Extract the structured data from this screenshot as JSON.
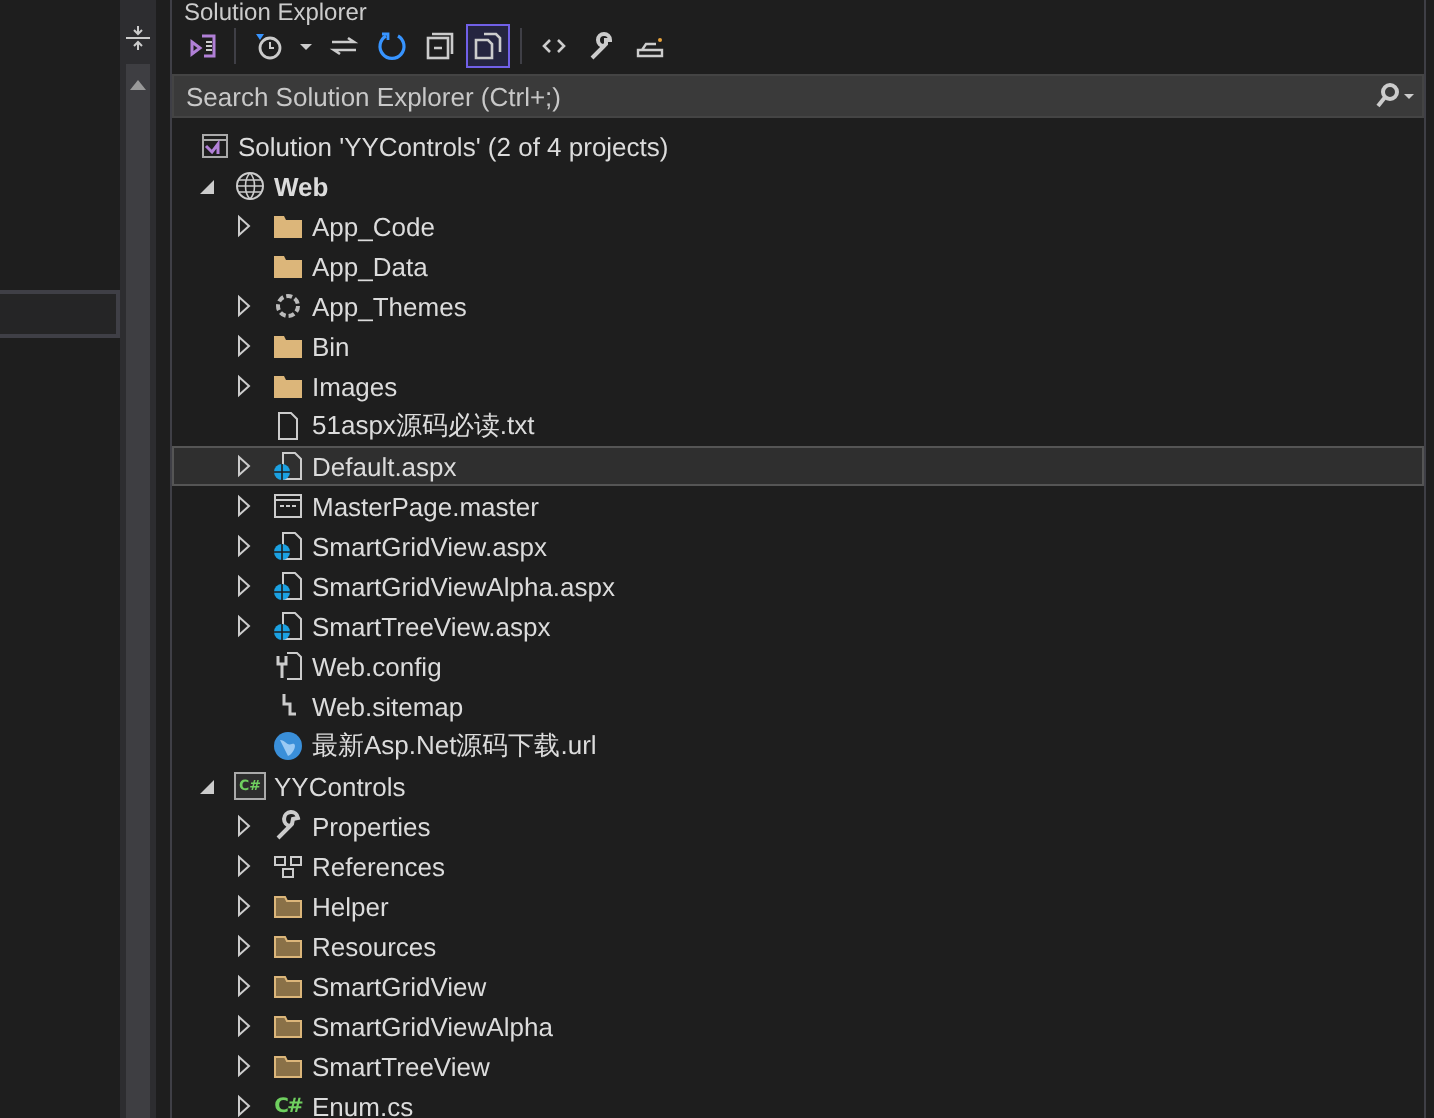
{
  "panel": {
    "title": "Solution Explorer"
  },
  "toolbar": [
    {
      "kind": "home",
      "selected": false
    },
    {
      "kind": "history",
      "selected": false
    },
    {
      "kind": "dropdown",
      "selected": false
    },
    {
      "kind": "sync",
      "selected": false
    },
    {
      "kind": "refresh",
      "selected": false
    },
    {
      "kind": "collapse",
      "selected": false
    },
    {
      "kind": "files",
      "selected": true
    },
    {
      "kind": "code",
      "selected": false
    },
    {
      "kind": "wrench",
      "selected": false
    },
    {
      "kind": "preview",
      "selected": false
    }
  ],
  "search": {
    "placeholder": "Search Solution Explorer (Ctrl+;)"
  },
  "solution": {
    "label": "Solution 'YYControls' (2 of 4 projects)",
    "projects": [
      {
        "label": "Web",
        "kind": "web",
        "startup": true,
        "expanded": true,
        "selected": false,
        "children": [
          {
            "label": "App_Code",
            "kind": "folder",
            "expanded": false,
            "selected": false
          },
          {
            "label": "App_Data",
            "kind": "folder",
            "selected": false
          },
          {
            "label": "App_Themes",
            "kind": "theme",
            "expanded": false,
            "selected": false
          },
          {
            "label": "Bin",
            "kind": "folder",
            "expanded": false,
            "selected": false
          },
          {
            "label": "Images",
            "kind": "folder",
            "expanded": false,
            "selected": false
          },
          {
            "label": "51aspx源码必读.txt",
            "kind": "file",
            "selected": false
          },
          {
            "label": "Default.aspx",
            "kind": "aspx",
            "expanded": false,
            "selected": true
          },
          {
            "label": "MasterPage.master",
            "kind": "master",
            "expanded": false,
            "selected": false
          },
          {
            "label": "SmartGridView.aspx",
            "kind": "aspx",
            "expanded": false,
            "selected": false
          },
          {
            "label": "SmartGridViewAlpha.aspx",
            "kind": "aspx",
            "expanded": false,
            "selected": false
          },
          {
            "label": "SmartTreeView.aspx",
            "kind": "aspx",
            "expanded": false,
            "selected": false
          },
          {
            "label": "Web.config",
            "kind": "config",
            "selected": false
          },
          {
            "label": "Web.sitemap",
            "kind": "sitemap",
            "selected": false
          },
          {
            "label": "最新Asp.Net源码下载.url",
            "kind": "url",
            "selected": false
          }
        ]
      },
      {
        "label": "YYControls",
        "kind": "csproj",
        "badge": "C#",
        "startup": false,
        "expanded": true,
        "selected": false,
        "children": [
          {
            "label": "Properties",
            "kind": "wrench",
            "expanded": false,
            "selected": false
          },
          {
            "label": "References",
            "kind": "references",
            "expanded": false,
            "selected": false
          },
          {
            "label": "Helper",
            "kind": "folder-outline",
            "expanded": false,
            "selected": false
          },
          {
            "label": "Resources",
            "kind": "folder-outline",
            "expanded": false,
            "selected": false
          },
          {
            "label": "SmartGridView",
            "kind": "folder-outline",
            "expanded": false,
            "selected": false
          },
          {
            "label": "SmartGridViewAlpha",
            "kind": "folder-outline",
            "expanded": false,
            "selected": false
          },
          {
            "label": "SmartTreeView",
            "kind": "folder-outline",
            "expanded": false,
            "selected": false
          },
          {
            "label": "Enum.cs",
            "kind": "cs",
            "badge": "C#",
            "expanded": false,
            "selected": false
          }
        ]
      }
    ]
  }
}
